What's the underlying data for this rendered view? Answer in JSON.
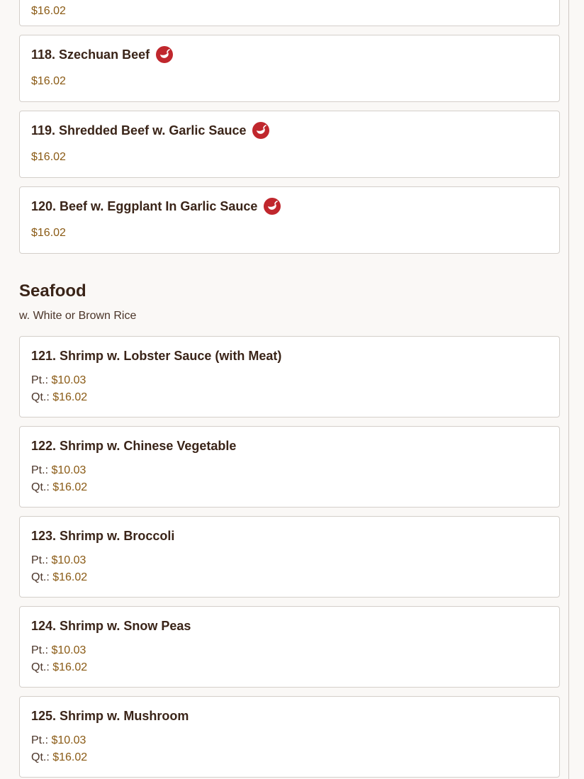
{
  "beef_items": [
    {
      "title": "",
      "price": "$16.02",
      "spicy": false
    },
    {
      "title": "118. Szechuan Beef",
      "price": "$16.02",
      "spicy": true
    },
    {
      "title": "119. Shredded Beef w. Garlic Sauce",
      "price": "$16.02",
      "spicy": true
    },
    {
      "title": "120. Beef w. Eggplant In Garlic Sauce",
      "price": "$16.02",
      "spicy": true
    }
  ],
  "seafood": {
    "title": "Seafood",
    "subtitle": "w. White or Brown Rice",
    "pt_label": "Pt.:",
    "qt_label": "Qt.:",
    "items": [
      {
        "title": "121. Shrimp w. Lobster Sauce (with Meat)",
        "pt": "$10.03",
        "qt": "$16.02"
      },
      {
        "title": "122. Shrimp w. Chinese Vegetable",
        "pt": "$10.03",
        "qt": "$16.02"
      },
      {
        "title": "123. Shrimp w. Broccoli",
        "pt": "$10.03",
        "qt": "$16.02"
      },
      {
        "title": "124. Shrimp w. Snow Peas",
        "pt": "$10.03",
        "qt": "$16.02"
      },
      {
        "title": "125. Shrimp w. Mushroom",
        "pt": "$10.03",
        "qt": "$16.02"
      }
    ]
  },
  "icons": {
    "spicy": "chili-pepper-icon"
  },
  "colors": {
    "price": "#8a5a14",
    "spicy": "#c0272d",
    "title": "#3a2418"
  }
}
